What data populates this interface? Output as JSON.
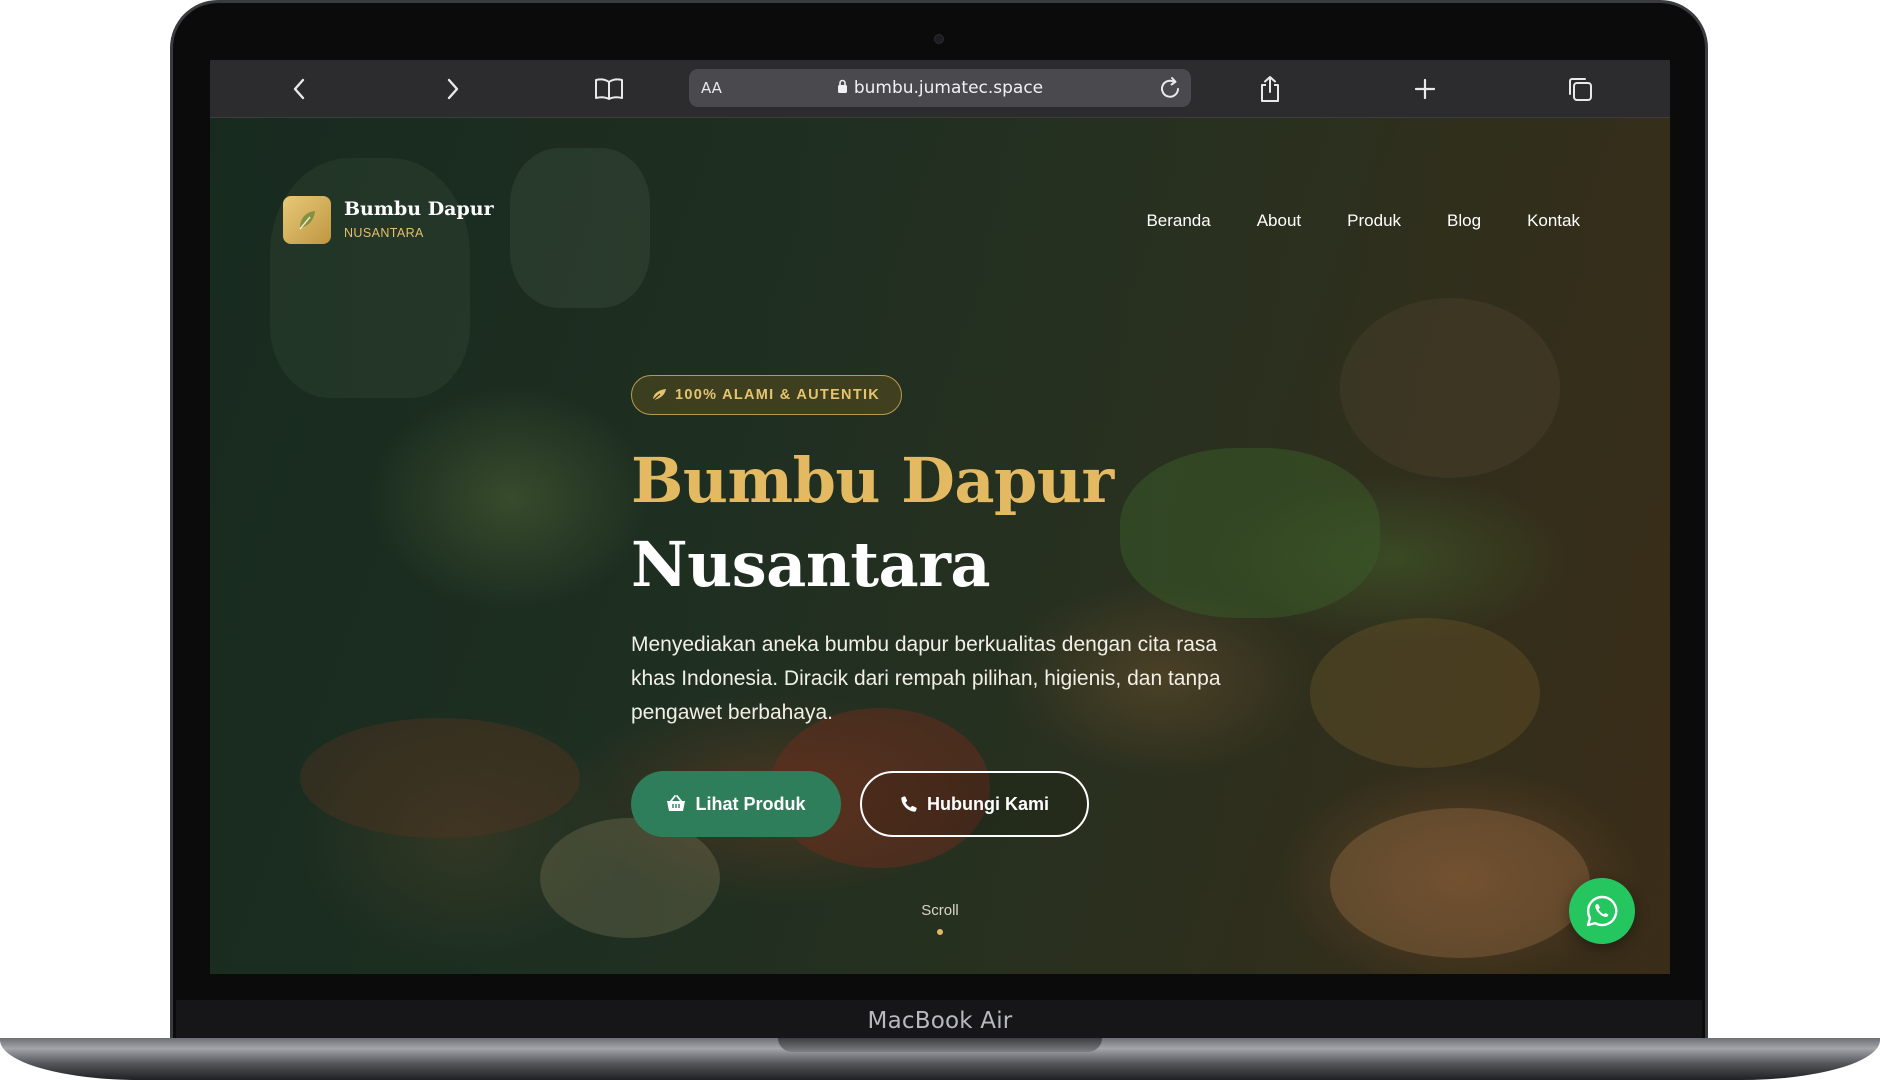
{
  "device": {
    "label": "MacBook Air"
  },
  "browser": {
    "address_aa": "AA",
    "url": "bumbu.jumatec.space",
    "icons": [
      "back-icon",
      "forward-icon",
      "bookmarks-icon",
      "lock-icon",
      "reload-icon",
      "share-icon",
      "new-tab-icon",
      "tabs-icon"
    ]
  },
  "site": {
    "brand_name": "Bumbu Dapur",
    "brand_sub": "NUSANTARA",
    "nav": [
      "Beranda",
      "About",
      "Produk",
      "Blog",
      "Kontak"
    ]
  },
  "hero": {
    "badge": "100% ALAMI & AUTENTIK",
    "title_line1": "Bumbu Dapur",
    "title_line2": "Nusantara",
    "description": "Menyediakan aneka bumbu dapur berkualitas dengan cita rasa khas Indonesia. Diracik dari rempah pilihan, higienis, dan tanpa pengawet berbahaya.",
    "primary_button": "Lihat Produk",
    "secondary_button": "Hubungi Kami",
    "scroll_label": "Scroll"
  },
  "colors": {
    "accent_gold": "#e3b962",
    "primary_green": "#2f7e5b",
    "whatsapp_green": "#25c55f"
  }
}
